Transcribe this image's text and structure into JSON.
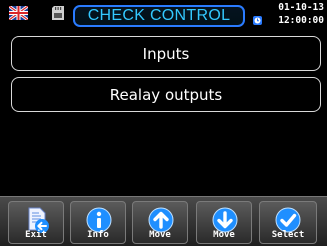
{
  "header": {
    "title": "CHECK CONTROL",
    "date": "01-10-13",
    "time": "12:00:00",
    "flag_icon": "uk-flag-icon",
    "sd_icon": "sd-card-icon",
    "clock_icon": "clock-icon"
  },
  "menu": {
    "items": [
      {
        "label": "Inputs"
      },
      {
        "label": "Realay outputs"
      }
    ]
  },
  "toolbar": {
    "buttons": [
      {
        "label": "Exit",
        "icon": "exit-document-icon"
      },
      {
        "label": "Info",
        "icon": "info-icon"
      },
      {
        "label": "Move",
        "icon": "arrow-up-icon"
      },
      {
        "label": "Move",
        "icon": "arrow-down-icon"
      },
      {
        "label": "Select",
        "icon": "checkmark-icon"
      }
    ]
  },
  "colors": {
    "title_text": "#33c8ff",
    "title_border": "#2a7bff",
    "icon_blue": "#1f8fff",
    "background": "#000000"
  }
}
